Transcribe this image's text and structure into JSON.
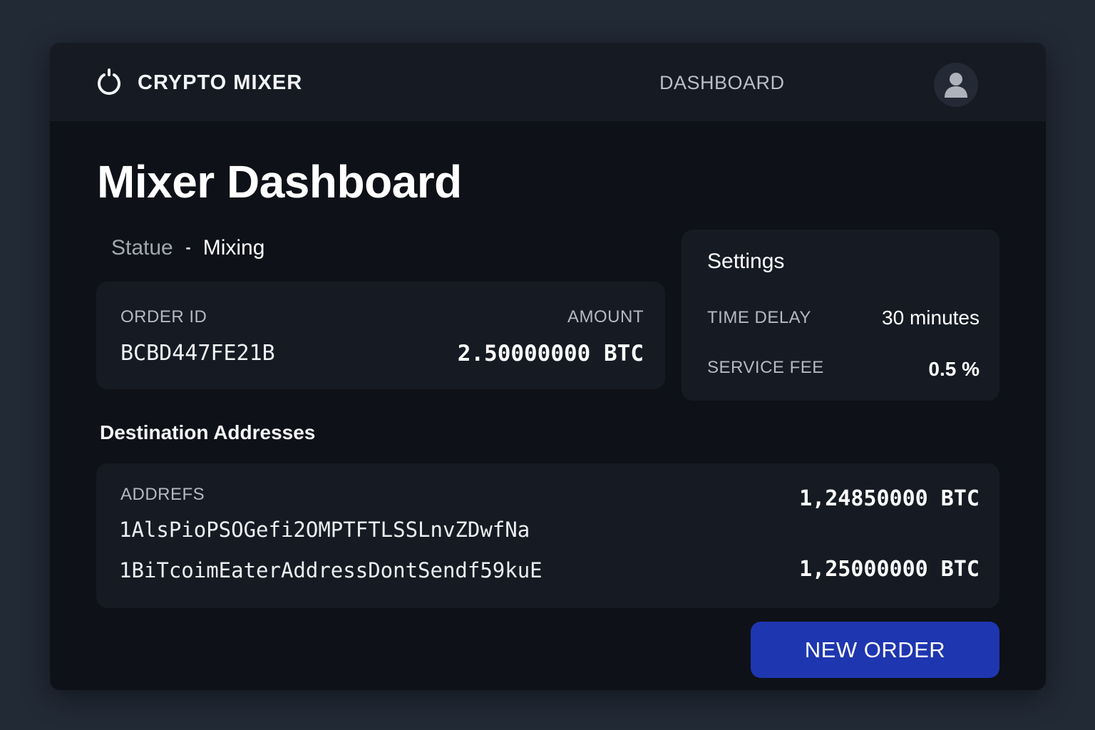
{
  "header": {
    "brand": "CRYPTO MIXER",
    "logo_icon": "power-ring-icon",
    "nav_dashboard": "DASHBOARD",
    "avatar_icon": "user-icon"
  },
  "main": {
    "title": "Mixer Dashboard",
    "status": {
      "label": "Statue",
      "value": "Mixing"
    }
  },
  "order": {
    "order_id_label": "ORDER ID",
    "order_id": "BCBD447FE21B",
    "amount_label": "AMOUNT",
    "amount": "2.50000000 BTC"
  },
  "settings": {
    "title": "Settings",
    "time_delay_label": "TIME DELAY",
    "time_delay_value": "30 minutes",
    "service_fee_label": "SERVICE FEE",
    "service_fee_value": "0.5 %"
  },
  "destinations": {
    "title": "Destination Addresses",
    "address_label": "ADDREFS",
    "items": [
      {
        "address": "1AlsPioPSOGefi2OMPTFTLSSLnvZDwfNa",
        "amount": "1,24850000 BTC"
      },
      {
        "address": "1BiTcoimEaterAddressDontSendf59kuE",
        "amount": "1,25000000 BTC"
      }
    ]
  },
  "actions": {
    "new_order": "NEW ORDER"
  },
  "colors": {
    "background": "#222a36",
    "panel": "#0e1117",
    "card": "#161b23",
    "accent": "#1e36b0"
  }
}
